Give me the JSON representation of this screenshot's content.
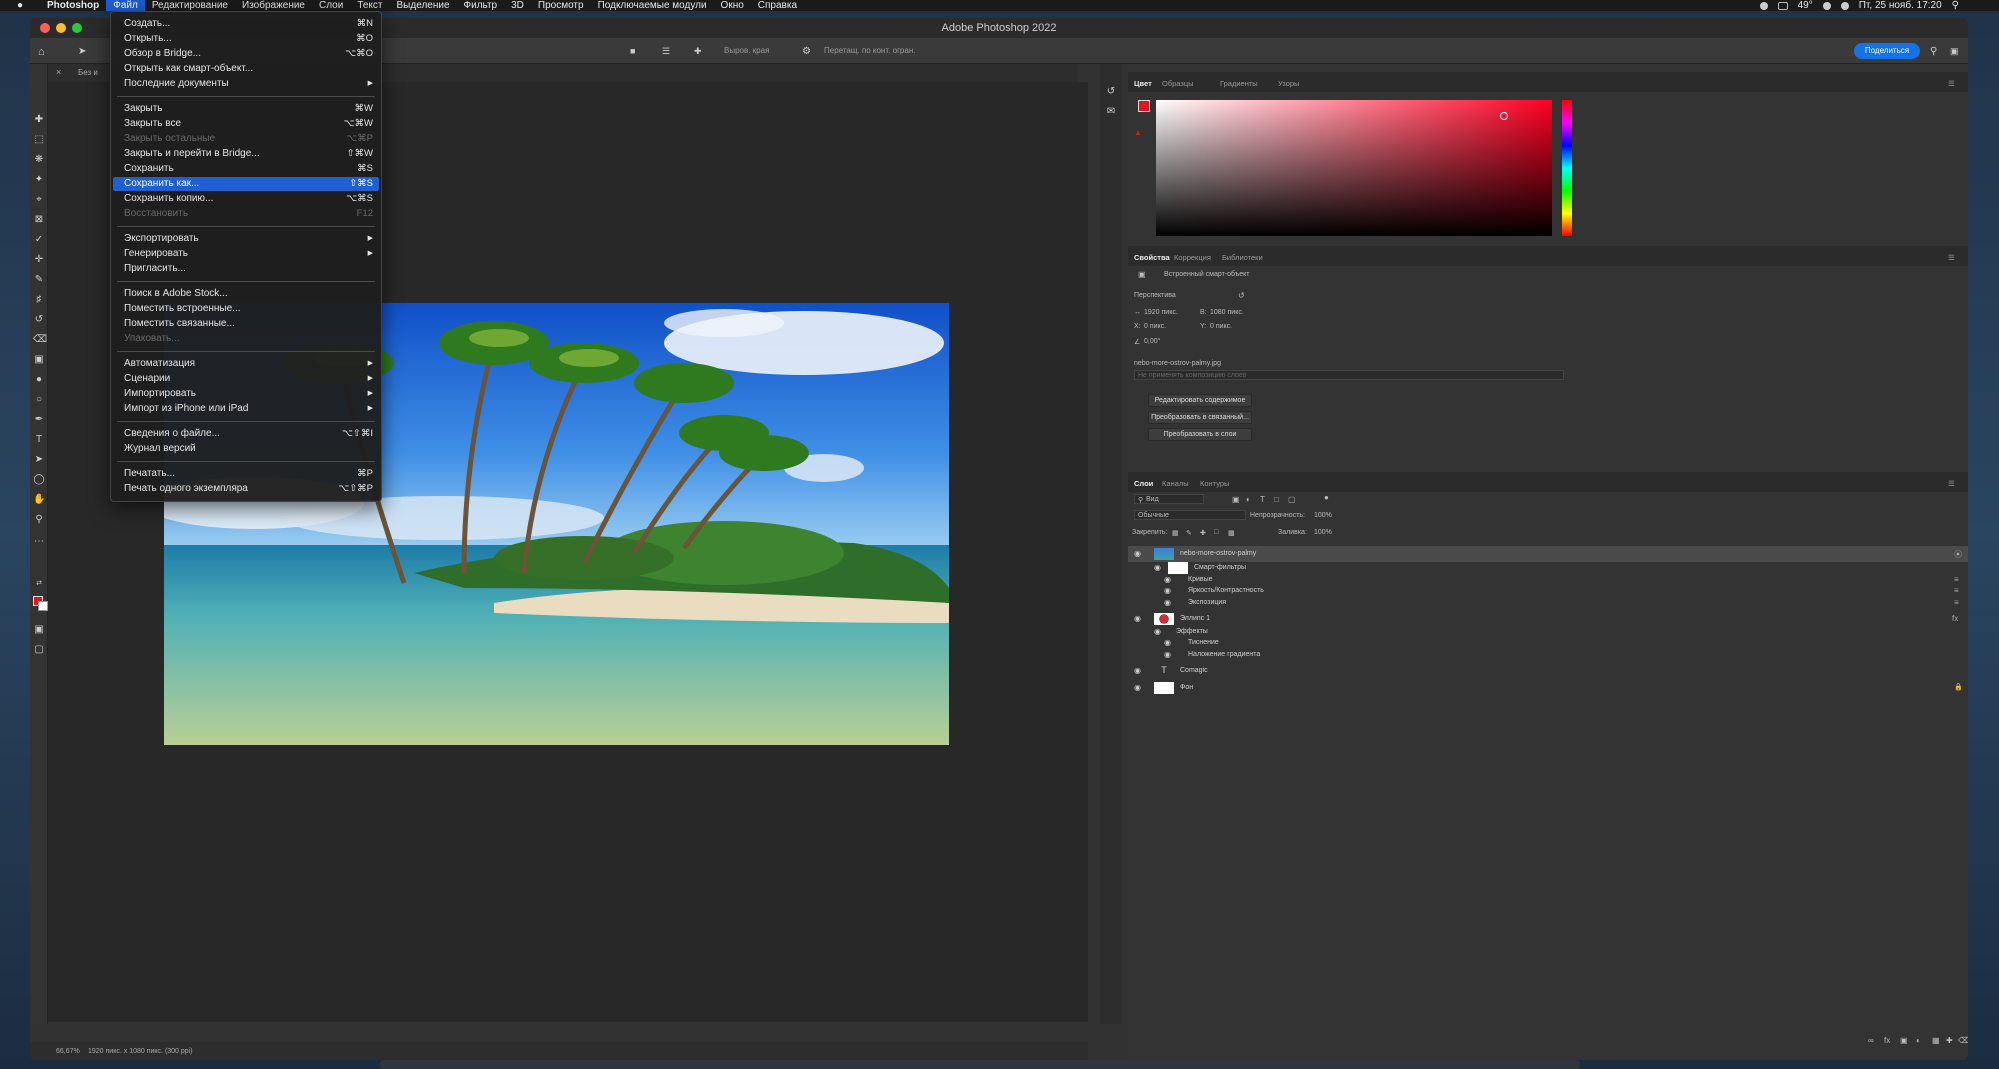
{
  "menubar": {
    "app": "Photoshop",
    "items": [
      "Файл",
      "Редактирование",
      "Изображение",
      "Слои",
      "Текст",
      "Выделение",
      "Фильтр",
      "3D",
      "Просмотр",
      "Подключаемые модули",
      "Окно",
      "Справка"
    ],
    "temperature": "49°",
    "datetime": "Пт, 25 нояб.  17:20"
  },
  "window": {
    "title": "Adobe Photoshop 2022"
  },
  "options_bar": {
    "align_label": "Выров. края",
    "drag_label": "Перетащ. по конт. огран.",
    "share_button": "Поделиться"
  },
  "tab": {
    "label": "Без и"
  },
  "file_menu": {
    "items": [
      {
        "label": "Создать...",
        "shortcut": "⌘N"
      },
      {
        "label": "Открыть...",
        "shortcut": "⌘O"
      },
      {
        "label": "Обзор в Bridge...",
        "shortcut": "⌥⌘O"
      },
      {
        "label": "Открыть как смарт-объект..."
      },
      {
        "label": "Последние документы",
        "submenu": true
      },
      {
        "sep": true
      },
      {
        "label": "Закрыть",
        "shortcut": "⌘W"
      },
      {
        "label": "Закрыть все",
        "shortcut": "⌥⌘W"
      },
      {
        "label": "Закрыть остальные",
        "shortcut": "⌥⌘P",
        "disabled": true
      },
      {
        "label": "Закрыть и перейти в Bridge...",
        "shortcut": "⇧⌘W"
      },
      {
        "label": "Сохранить",
        "shortcut": "⌘S"
      },
      {
        "label": "Сохранить как...",
        "shortcut": "⇧⌘S",
        "highlighted": true
      },
      {
        "label": "Сохранить копию...",
        "shortcut": "⌥⌘S"
      },
      {
        "label": "Восстановить",
        "shortcut": "F12",
        "disabled": true
      },
      {
        "sep": true
      },
      {
        "label": "Экспортировать",
        "submenu": true
      },
      {
        "label": "Генерировать",
        "submenu": true
      },
      {
        "label": "Пригласить..."
      },
      {
        "sep": true
      },
      {
        "label": "Поиск в Adobe Stock..."
      },
      {
        "label": "Поместить встроенные..."
      },
      {
        "label": "Поместить связанные..."
      },
      {
        "label": "Упаковать...",
        "disabled": true
      },
      {
        "sep": true
      },
      {
        "label": "Автоматизация",
        "submenu": true
      },
      {
        "label": "Сценарии",
        "submenu": true
      },
      {
        "label": "Импортировать",
        "submenu": true
      },
      {
        "label": "Импорт из iPhone или iPad",
        "submenu": true
      },
      {
        "sep": true
      },
      {
        "label": "Сведения о файле...",
        "shortcut": "⌥⇧⌘I"
      },
      {
        "label": "Журнал версий"
      },
      {
        "sep": true
      },
      {
        "label": "Печатать...",
        "shortcut": "⌘P"
      },
      {
        "label": "Печать одного экземпляра",
        "shortcut": "⌥⇧⌘P"
      }
    ]
  },
  "color_panel": {
    "tabs": [
      "Цвет",
      "Образцы",
      "Градиенты",
      "Узоры"
    ]
  },
  "properties_panel": {
    "tabs": [
      "Свойства",
      "Коррекция",
      "Библиотеки"
    ],
    "object_type": "Встроенный смарт-объект",
    "section": "Перспектива",
    "width": "1920 пикс.",
    "height": "1080 пикс.",
    "x": "0 пикс.",
    "y": "0 пикс.",
    "angle": "0,00°",
    "filename": "nebo-more-ostrov-palmy.jpg",
    "comp_placeholder": "Не применять композицию слоев",
    "buttons": [
      "Редактировать содержимое",
      "Преобразовать в связанный...",
      "Преобразовать в слои"
    ]
  },
  "layers_panel": {
    "tabs": [
      "Слои",
      "Каналы",
      "Контуры"
    ],
    "filter": "Вид",
    "blend_mode": "Обычные",
    "opacity_label": "Непрозрачность:",
    "opacity": "100%",
    "lock_label": "Закрепить:",
    "fill_label": "Заливка:",
    "fill": "100%",
    "layers": [
      {
        "name": "nebo-more-ostrov-palmy",
        "level": 0,
        "selected": true
      },
      {
        "name": "Смарт-фильтры",
        "level": 1
      },
      {
        "name": "Кривые",
        "level": 2
      },
      {
        "name": "Яркость/Контрастность",
        "level": 2
      },
      {
        "name": "Экспозиция",
        "level": 2
      },
      {
        "name": "Эллипс 1",
        "level": 0
      },
      {
        "name": "Эффекты",
        "level": 1
      },
      {
        "name": "Тиснение",
        "level": 2
      },
      {
        "name": "Наложение градиента",
        "level": 2
      },
      {
        "name": "Comagic",
        "level": 0
      },
      {
        "name": "Фон",
        "level": 0
      }
    ]
  },
  "status_bar": {
    "zoom": "66,67%",
    "doc_info": "1920 пикс. x 1080 пикс. (300 ppi)"
  },
  "colors": {
    "accent": "#1f5fd1",
    "foreground": "#e3141d",
    "share": "#1473e6"
  }
}
